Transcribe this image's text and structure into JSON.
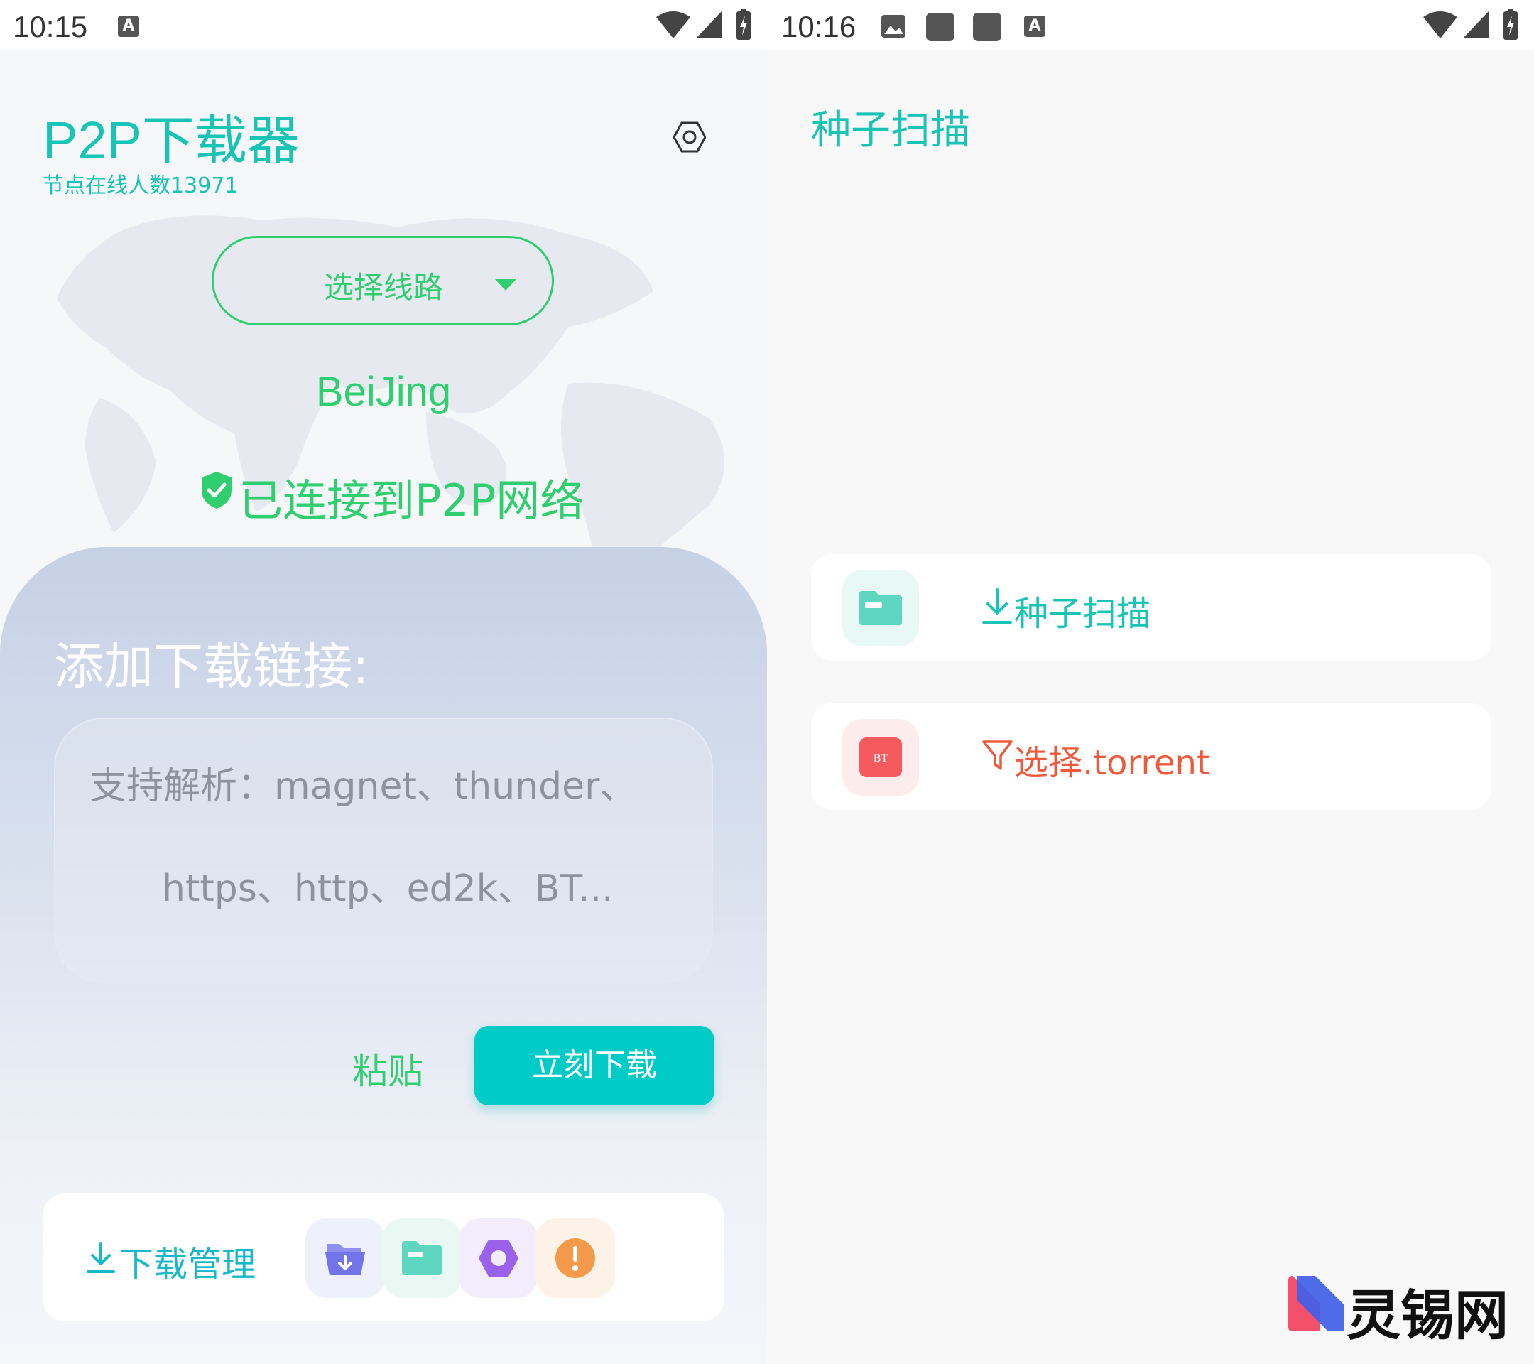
{
  "left": {
    "status": {
      "time": "10:15"
    },
    "header": {
      "title": "P2P下载器",
      "subtitle": "节点在线人数13971"
    },
    "route": {
      "label": "选择线路",
      "city": "BeiJing",
      "connected": "已连接到P2P网络"
    },
    "panel": {
      "title": "添加下载链接:",
      "placeholder_line1": "支持解析：magnet、thunder、",
      "placeholder_line2": "https、http、ed2k、BT...",
      "paste_label": "粘贴",
      "download_label": "立刻下载"
    },
    "bottom": {
      "manager_label": "下载管理"
    }
  },
  "right": {
    "status": {
      "time": "10:16"
    },
    "title": "种子扫描",
    "cards": [
      {
        "label": "种子扫描",
        "color": "#17c4b5",
        "icon": "folder-icon",
        "glyph": "download-icon"
      },
      {
        "label": "选择.torrent",
        "color": "#ef5a3c",
        "icon": "bt-file-icon",
        "glyph": "filter-icon",
        "badge": "BT"
      }
    ]
  },
  "watermark": {
    "text": "灵锡网"
  },
  "colors": {
    "teal": "#17c4b5",
    "green": "#2fcf6f",
    "button": "#00cbc6",
    "red": "#ef5a3c"
  }
}
